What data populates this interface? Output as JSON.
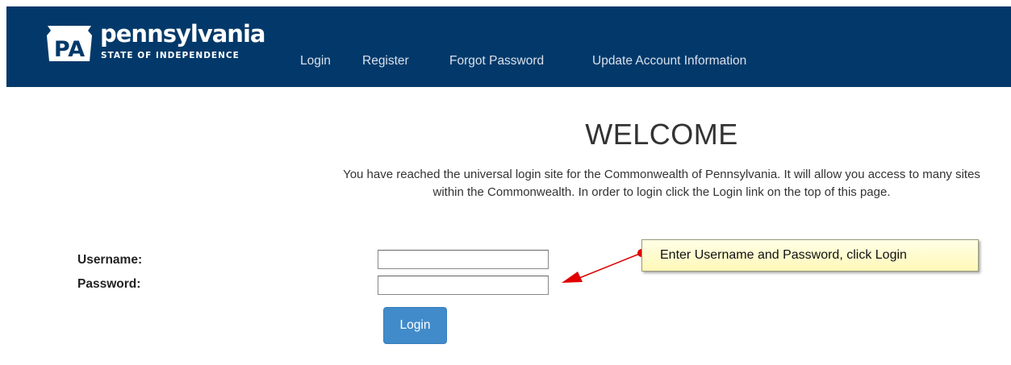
{
  "header": {
    "logo_badge": "PA",
    "logo_word": "pennsylvania",
    "logo_tagline": "STATE OF INDEPENDENCE",
    "bg_color": "#03396a",
    "nav": [
      {
        "label": "Login"
      },
      {
        "label": "Register"
      },
      {
        "label": "Forgot Password"
      },
      {
        "label": "Update Account Information"
      }
    ]
  },
  "main": {
    "title": "WELCOME",
    "intro": "You have reached the universal login site for the Commonwealth of Pennsylvania. It will allow you access to many sites within the Commonwealth. In order to login click the Login link on the top of this page."
  },
  "form": {
    "username_label": "Username:",
    "username_value": "",
    "password_label": "Password:",
    "password_value": "",
    "login_button": "Login",
    "button_color": "#428bca"
  },
  "callout": {
    "text": "Enter Username and Password, click Login",
    "arrow_color": "#e00000"
  }
}
